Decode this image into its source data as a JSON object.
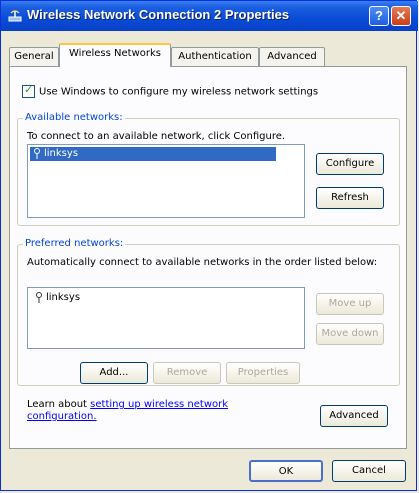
{
  "window": {
    "title": "Wireless Network Connection 2 Properties",
    "help_button": "?",
    "close_button": "✕"
  },
  "tabs": [
    "General",
    "Wireless Networks",
    "Authentication",
    "Advanced"
  ],
  "use_windows_checkbox": {
    "label": "Use Windows to configure my wireless network settings",
    "checked": true
  },
  "available": {
    "group_label": "Available networks:",
    "instructions": "To connect to an available network, click Configure.",
    "networks": [
      "linksys"
    ],
    "configure_button": "Configure",
    "refresh_button": "Refresh"
  },
  "preferred": {
    "group_label": "Preferred networks:",
    "instructions": "Automatically connect to available networks in the order listed below:",
    "networks": [
      "linksys"
    ],
    "move_up_button": "Move up",
    "move_down_button": "Move down",
    "add_button": "Add...",
    "remove_button": "Remove",
    "properties_button": "Properties"
  },
  "learn": {
    "prefix": "Learn about ",
    "link": "setting up wireless network configuration.",
    "advanced_button": "Advanced"
  },
  "dialog": {
    "ok_button": "OK",
    "cancel_button": "Cancel"
  }
}
